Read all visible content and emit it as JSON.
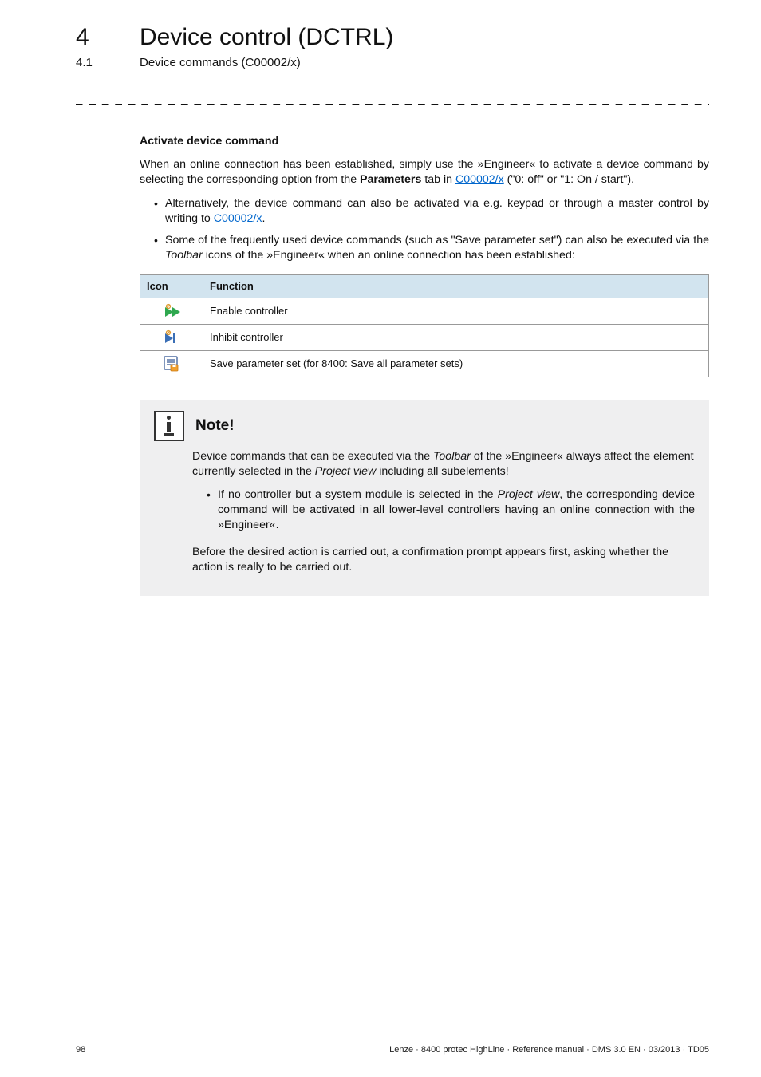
{
  "header": {
    "chapter_number": "4",
    "chapter_title": "Device control (DCTRL)",
    "section_number": "4.1",
    "section_title": "Device commands (C00002/x)",
    "dashes": "_ _ _ _ _ _ _ _ _ _ _ _ _ _ _ _ _ _ _ _ _ _ _ _ _ _ _ _ _ _ _ _ _ _ _ _ _ _ _ _ _ _ _ _ _ _ _ _ _ _ _ _ _ _ _ _ _ _ _ _ _ _ _ _"
  },
  "body": {
    "heading": "Activate device command",
    "intro_a": "When an online connection has been established, simply use the »Engineer« to activate a device command by selecting the corresponding option from the ",
    "intro_bold": "Parameters",
    "intro_b": " tab in ",
    "link_text": "C00002/x",
    "intro_c": " (\"0: off\" or \"1: On / start\").",
    "bullet1_a": "Alternatively, the device command can also be activated via e.g. keypad or through a master control by writing to ",
    "bullet1_b": ".",
    "bullet2_a": "Some of the frequently used device commands (such as \"Save parameter set\") can also be executed via the ",
    "bullet2_em": "Toolbar",
    "bullet2_b": " icons of the »Engineer« when an online connection has been established:"
  },
  "table": {
    "headers": [
      "Icon",
      "Function"
    ],
    "rows": [
      {
        "icon": "enable-controller-icon",
        "function": "Enable controller"
      },
      {
        "icon": "inhibit-controller-icon",
        "function": "Inhibit controller"
      },
      {
        "icon": "save-parameter-icon",
        "function": "Save parameter set (for 8400: Save all parameter sets)"
      }
    ]
  },
  "note": {
    "title": "Note!",
    "p1_a": "Device commands that can be executed via the ",
    "p1_em1": "Toolbar",
    "p1_b": " of the »Engineer« always affect the element currently selected in the ",
    "p1_em2": "Project view",
    "p1_c": " including all subelements!",
    "bullet_a": "If no controller but a system module is selected in the ",
    "bullet_em": "Project view",
    "bullet_b": ", the corresponding device command will be activated in all lower-level controllers having an online connection with the »Engineer«.",
    "p2": "Before the desired action is carried out, a confirmation prompt appears first, asking whether the action is really to be carried out."
  },
  "footer": {
    "page": "98",
    "info": "Lenze · 8400 protec HighLine · Reference manual · DMS 3.0 EN · 03/2013 · TD05"
  }
}
